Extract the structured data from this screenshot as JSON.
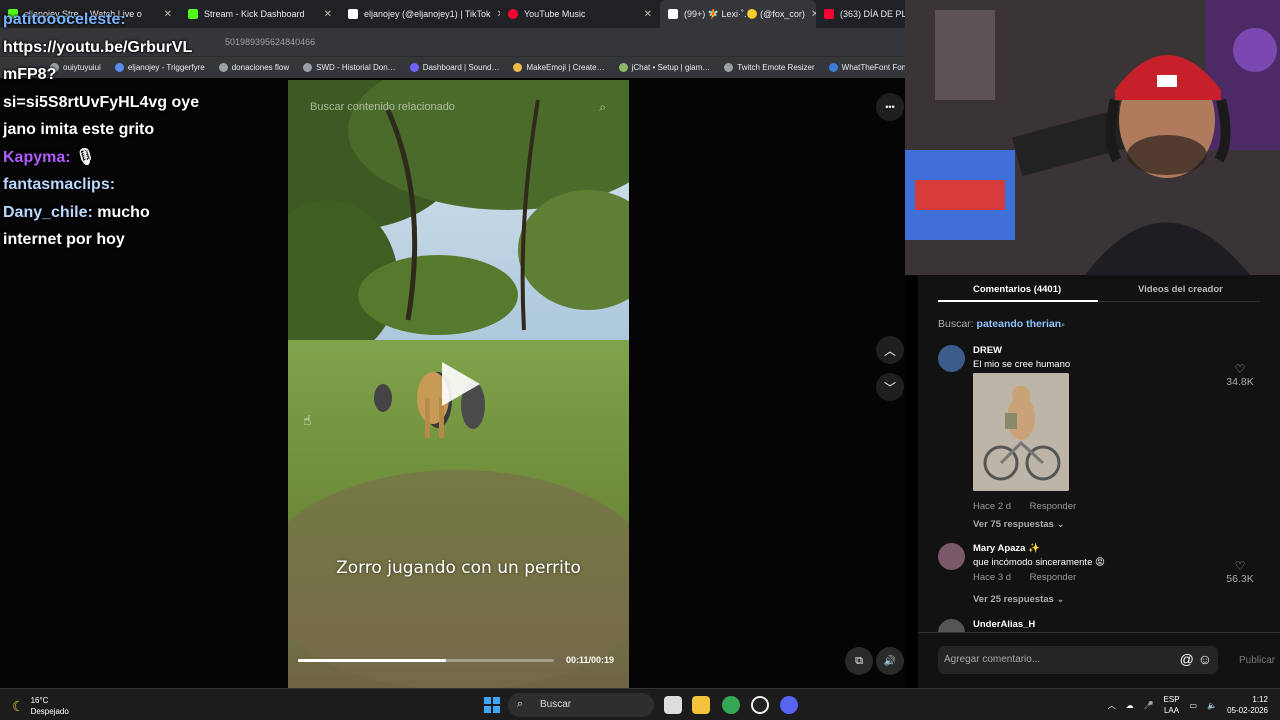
{
  "browser": {
    "tabs": [
      {
        "title": "eljanojey Stre… Watch Live o",
        "fav_color": "#53fc18",
        "active": false
      },
      {
        "title": "Stream - Kick Dashboard",
        "fav_color": "#53fc18",
        "active": false
      },
      {
        "title": "eljanojey (@eljanojey1) | TikTok",
        "fav_color": "#ffffff",
        "active": false
      },
      {
        "title": "YouTube Music",
        "fav_color": "#ff0033",
        "active": false
      },
      {
        "title": "(99+) 🧚 Lexi·˚.🟡 (@fox_cor)",
        "fav_color": "#ffffff",
        "active": true
      },
      {
        "title": "(363) DÍA DE PLAY",
        "fav_color": "#ff0033",
        "active": false
      }
    ],
    "close_glyph": "✕",
    "address_fragment": "501989395624840466",
    "bookmarks": [
      "ouiytuyuiui",
      "eljanojey - Triggerfyre",
      "donaciones flow",
      "SWD - Historial Don…",
      "Dashboard | Sound…",
      "MakeEmoji | Create…",
      "jChat • Setup | giam…",
      "Twitch Emote Resizer",
      "WhatTheFont Font I…"
    ]
  },
  "chat": {
    "lines": [
      {
        "user": "patitoooceleste:",
        "user_color": "blue",
        "text": ""
      },
      {
        "user": "",
        "text": "https://youtu.be/GrburVL"
      },
      {
        "user": "",
        "text": "mFP8?"
      },
      {
        "user": "",
        "text": "si=si5S8rtUvFyHL4vg oye"
      },
      {
        "user": "",
        "text": "jano imita este grito"
      },
      {
        "user": "Kapyma:",
        "user_color": "purple",
        "text": "🎙"
      },
      {
        "user": "fantasmaclips:",
        "user_color": "lightblue",
        "text": ""
      },
      {
        "user": "Dany_chile:",
        "user_color": "lightblue",
        "text": "mucho"
      },
      {
        "user": "",
        "text": "internet por hoy"
      }
    ]
  },
  "video": {
    "search_placeholder": "Buscar contenido relacionado",
    "caption": "Zorro jugando con un perrito",
    "time": "00:11/00:19",
    "progress": 0.58
  },
  "controls": {
    "more": "•••",
    "up": "︿",
    "down": "﹀",
    "pip": "⧉",
    "volume": "🔊"
  },
  "comments_panel": {
    "tab_comments": "Comentarios (4401)",
    "tab_creator": "Videos del creador",
    "search_label": "Buscar:",
    "search_term": "pateando therian",
    "search_icon": "🔍",
    "comments": [
      {
        "name": "DREW",
        "text": "El mio se cree humano",
        "time": "Hace 2 d",
        "reply": "Responder",
        "replies": "Ver 75 respuestas",
        "likes": "34.8K",
        "avatar_color": "#3c5d8c"
      },
      {
        "name": "Mary Apaza ✨",
        "text": "que incómodo sinceramente 😡",
        "time": "Hace 3 d",
        "reply": "Responder",
        "replies": "Ver 25 respuestas",
        "likes": "56.3K",
        "avatar_color": "#7a5a6a"
      },
      {
        "name": "UnderAlias_H",
        "text": "",
        "time": "",
        "reply": "",
        "replies": "",
        "likes": "",
        "avatar_color": "#555555"
      }
    ],
    "composer_placeholder": "Agregar comentario...",
    "composer_icons": "@ ☺",
    "publish": "Publicar"
  },
  "taskbar": {
    "temp": "16°C",
    "weather": "Despejado",
    "search": "Buscar",
    "lang_top": "ESP",
    "lang_bottom": "LAA",
    "time": "1:12",
    "date": "05-02-2026"
  }
}
